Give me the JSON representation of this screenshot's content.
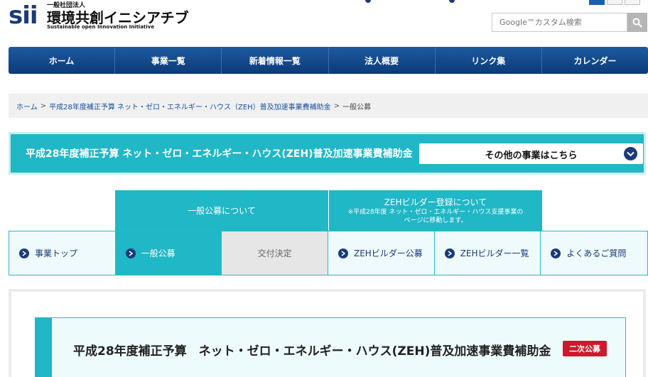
{
  "header": {
    "logo_mark": "sii",
    "logo_org": "一般社団法人",
    "logo_name": "環境共創イニシアチブ",
    "logo_subtitle": "Sustainable open Innovation Initiative",
    "search_placeholder": "Google™カスタム検索"
  },
  "global_nav": {
    "items": [
      {
        "label": "ホーム"
      },
      {
        "label": "事業一覧"
      },
      {
        "label": "新着情報一覧"
      },
      {
        "label": "法人概要"
      },
      {
        "label": "リンク集"
      },
      {
        "label": "カレンダー"
      }
    ]
  },
  "breadcrumb": {
    "home": "ホーム",
    "sep": ">",
    "program": "平成28年度補正予算 ネット・ゼロ・エネルギー・ハウス（ZEH）普及加速事業費補助金",
    "current": "一般公募"
  },
  "banner": {
    "title": "平成28年度補正予算 ネット・ゼロ・エネルギー・ハウス(ZEH)普及加速事業費補助金",
    "select_label": "その他の事業はこちら"
  },
  "upper_tabs": {
    "general": "一般公募について",
    "builder": "ZEHビルダー登録について",
    "builder_note_1": "※平成28年度 ネット・ゼロ・エネルギー・ハウス支援事業の",
    "builder_note_2": "ページに移動します。"
  },
  "sub_nav": {
    "items": [
      {
        "label": "事業トップ"
      },
      {
        "label": "一般公募"
      },
      {
        "label": "交付決定"
      },
      {
        "label": "ZEHビルダー公募"
      },
      {
        "label": "ZEHビルダー一覧"
      },
      {
        "label": "よくあるご質問"
      }
    ]
  },
  "content": {
    "title": "平成28年度補正予算　ネット・ゼロ・エネルギー・ハウス(ZEH)普及加速事業費補助金",
    "badge": "二次公募"
  },
  "colors": {
    "navy": "#1a3a78",
    "teal": "#20b7c6",
    "badge_red": "#d0172c"
  }
}
